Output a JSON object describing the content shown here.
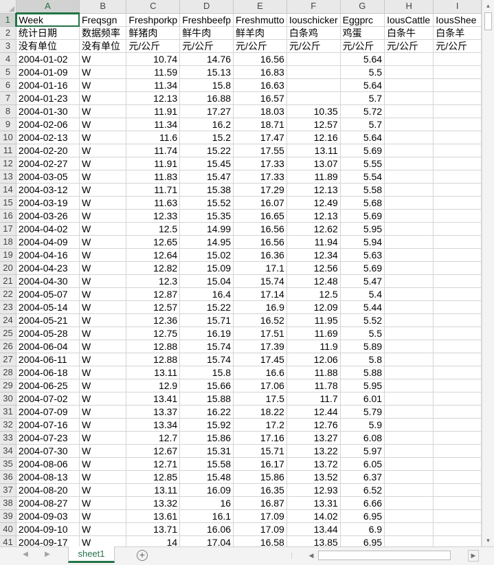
{
  "sheet": {
    "active_cell": "A1",
    "columns": [
      "A",
      "B",
      "C",
      "D",
      "E",
      "F",
      "G",
      "H",
      "I"
    ],
    "header_rows": [
      [
        "Week",
        "Freqsgn",
        "Freshporkp",
        "Freshbeefp",
        "Freshmutto",
        "Iouschicker",
        "Eggprc",
        "IousCattle",
        "IousShee"
      ],
      [
        "统计日期",
        "数据频率",
        "鲜猪肉",
        "鲜牛肉",
        "鲜羊肉",
        "白条鸡",
        "鸡蛋",
        "白条牛",
        "白条羊"
      ],
      [
        "没有单位",
        "没有单位",
        "元/公斤",
        "元/公斤",
        "元/公斤",
        "元/公斤",
        "元/公斤",
        "元/公斤",
        "元/公斤"
      ]
    ],
    "data_rows": [
      [
        "2004-01-02",
        "W",
        "10.74",
        "14.76",
        "16.56",
        "",
        "5.64",
        "",
        ""
      ],
      [
        "2004-01-09",
        "W",
        "11.59",
        "15.13",
        "16.83",
        "",
        "5.5",
        "",
        ""
      ],
      [
        "2004-01-16",
        "W",
        "11.34",
        "15.8",
        "16.63",
        "",
        "5.64",
        "",
        ""
      ],
      [
        "2004-01-23",
        "W",
        "12.13",
        "16.88",
        "16.57",
        "",
        "5.7",
        "",
        ""
      ],
      [
        "2004-01-30",
        "W",
        "11.91",
        "17.27",
        "18.03",
        "10.35",
        "5.72",
        "",
        ""
      ],
      [
        "2004-02-06",
        "W",
        "11.34",
        "16.2",
        "18.71",
        "12.57",
        "5.7",
        "",
        ""
      ],
      [
        "2004-02-13",
        "W",
        "11.6",
        "15.2",
        "17.47",
        "12.16",
        "5.64",
        "",
        ""
      ],
      [
        "2004-02-20",
        "W",
        "11.74",
        "15.22",
        "17.55",
        "13.11",
        "5.69",
        "",
        ""
      ],
      [
        "2004-02-27",
        "W",
        "11.91",
        "15.45",
        "17.33",
        "13.07",
        "5.55",
        "",
        ""
      ],
      [
        "2004-03-05",
        "W",
        "11.83",
        "15.47",
        "17.33",
        "11.89",
        "5.54",
        "",
        ""
      ],
      [
        "2004-03-12",
        "W",
        "11.71",
        "15.38",
        "17.29",
        "12.13",
        "5.58",
        "",
        ""
      ],
      [
        "2004-03-19",
        "W",
        "11.63",
        "15.52",
        "16.07",
        "12.49",
        "5.68",
        "",
        ""
      ],
      [
        "2004-03-26",
        "W",
        "12.33",
        "15.35",
        "16.65",
        "12.13",
        "5.69",
        "",
        ""
      ],
      [
        "2004-04-02",
        "W",
        "12.5",
        "14.99",
        "16.56",
        "12.62",
        "5.95",
        "",
        ""
      ],
      [
        "2004-04-09",
        "W",
        "12.65",
        "14.95",
        "16.56",
        "11.94",
        "5.94",
        "",
        ""
      ],
      [
        "2004-04-16",
        "W",
        "12.64",
        "15.02",
        "16.36",
        "12.34",
        "5.63",
        "",
        ""
      ],
      [
        "2004-04-23",
        "W",
        "12.82",
        "15.09",
        "17.1",
        "12.56",
        "5.69",
        "",
        ""
      ],
      [
        "2004-04-30",
        "W",
        "12.3",
        "15.04",
        "15.74",
        "12.48",
        "5.47",
        "",
        ""
      ],
      [
        "2004-05-07",
        "W",
        "12.87",
        "16.4",
        "17.14",
        "12.5",
        "5.4",
        "",
        ""
      ],
      [
        "2004-05-14",
        "W",
        "12.57",
        "15.22",
        "16.9",
        "12.09",
        "5.44",
        "",
        ""
      ],
      [
        "2004-05-21",
        "W",
        "12.36",
        "15.71",
        "16.52",
        "11.95",
        "5.52",
        "",
        ""
      ],
      [
        "2004-05-28",
        "W",
        "12.75",
        "16.19",
        "17.51",
        "11.69",
        "5.5",
        "",
        ""
      ],
      [
        "2004-06-04",
        "W",
        "12.88",
        "15.74",
        "17.39",
        "11.9",
        "5.89",
        "",
        ""
      ],
      [
        "2004-06-11",
        "W",
        "12.88",
        "15.74",
        "17.45",
        "12.06",
        "5.8",
        "",
        ""
      ],
      [
        "2004-06-18",
        "W",
        "13.11",
        "15.8",
        "16.6",
        "11.88",
        "5.88",
        "",
        ""
      ],
      [
        "2004-06-25",
        "W",
        "12.9",
        "15.66",
        "17.06",
        "11.78",
        "5.95",
        "",
        ""
      ],
      [
        "2004-07-02",
        "W",
        "13.41",
        "15.88",
        "17.5",
        "11.7",
        "6.01",
        "",
        ""
      ],
      [
        "2004-07-09",
        "W",
        "13.37",
        "16.22",
        "18.22",
        "12.44",
        "5.79",
        "",
        ""
      ],
      [
        "2004-07-16",
        "W",
        "13.34",
        "15.92",
        "17.2",
        "12.76",
        "5.9",
        "",
        ""
      ],
      [
        "2004-07-23",
        "W",
        "12.7",
        "15.86",
        "17.16",
        "13.27",
        "6.08",
        "",
        ""
      ],
      [
        "2004-07-30",
        "W",
        "12.67",
        "15.31",
        "15.71",
        "13.22",
        "5.97",
        "",
        ""
      ],
      [
        "2004-08-06",
        "W",
        "12.71",
        "15.58",
        "16.17",
        "13.72",
        "6.05",
        "",
        ""
      ],
      [
        "2004-08-13",
        "W",
        "12.85",
        "15.48",
        "15.86",
        "13.52",
        "6.37",
        "",
        ""
      ],
      [
        "2004-08-20",
        "W",
        "13.11",
        "16.09",
        "16.35",
        "12.93",
        "6.52",
        "",
        ""
      ],
      [
        "2004-08-27",
        "W",
        "13.32",
        "16",
        "16.87",
        "13.31",
        "6.66",
        "",
        ""
      ],
      [
        "2004-09-03",
        "W",
        "13.61",
        "16.1",
        "17.09",
        "14.02",
        "6.95",
        "",
        ""
      ],
      [
        "2004-09-10",
        "W",
        "13.71",
        "16.06",
        "17.09",
        "13.44",
        "6.9",
        "",
        ""
      ],
      [
        "2004-09-17",
        "W",
        "14",
        "17.04",
        "16.58",
        "13.85",
        "6.95",
        "",
        ""
      ]
    ]
  },
  "tabs": {
    "sheet1": "sheet1",
    "add_icon": "plus-circle-icon"
  },
  "colors": {
    "accent": "#217346",
    "grid": "#d4d4d4",
    "header_bg": "#e9e9e9"
  }
}
